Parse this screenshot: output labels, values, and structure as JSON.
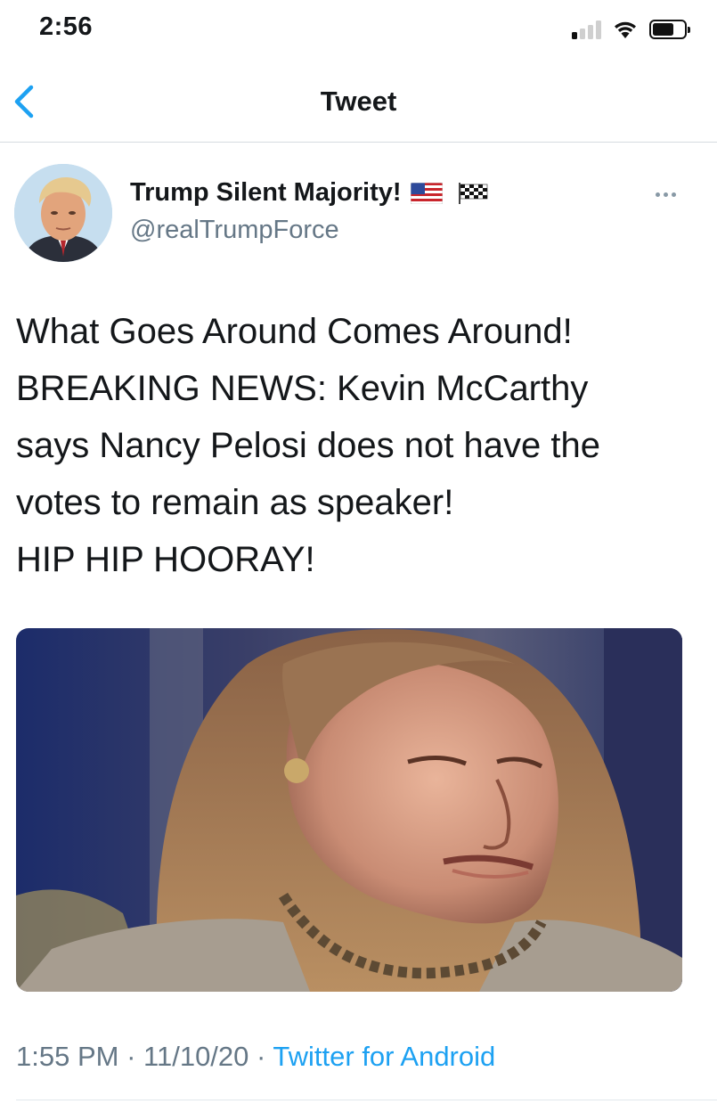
{
  "status_bar": {
    "time": "2:56",
    "signal_bars_active": 1,
    "signal_bars_total": 4,
    "battery_level": 0.7,
    "icons": [
      "signal-icon",
      "wifi-icon",
      "battery-icon"
    ]
  },
  "header": {
    "back_icon": "chevron-left-icon",
    "title": "Tweet",
    "accent_color": "#1da1f2"
  },
  "tweet": {
    "author": {
      "display_name": "Trump Silent Majority!",
      "name_emojis": [
        "us-flag-icon",
        "checkered-flag-icon"
      ],
      "handle": "@realTrumpForce"
    },
    "more_icon": "more-horizontal-icon",
    "text_lines": [
      "What Goes Around Comes Around!",
      "BREAKING NEWS: Kevin McCarthy",
      "says Nancy Pelosi does not have the",
      "votes to remain as speaker!",
      "HIP HIP HOORAY!"
    ],
    "meta": {
      "time": "1:55 PM",
      "separator": "·",
      "date": "11/10/20",
      "source": "Twitter for Android"
    }
  }
}
